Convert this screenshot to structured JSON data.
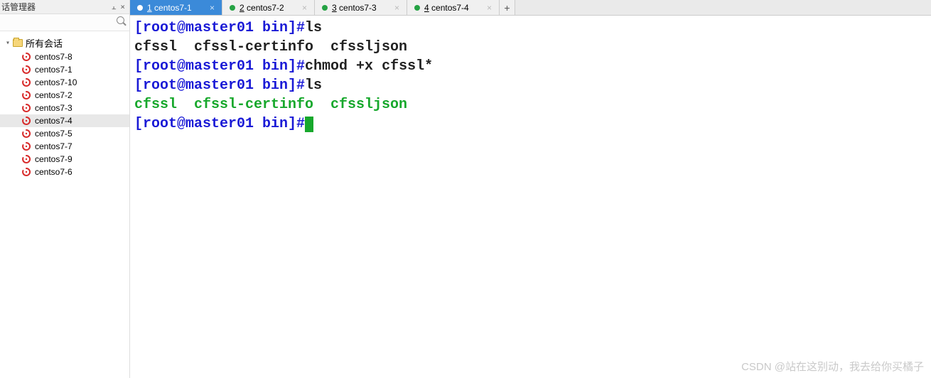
{
  "sidebar": {
    "title": "话管理器",
    "pin_glyph": "⫠",
    "close_glyph": "×",
    "root_label": "所有会话",
    "toggle_glyph": "▾",
    "items": [
      {
        "label": "centos7-8",
        "selected": false
      },
      {
        "label": "centos7-1",
        "selected": false
      },
      {
        "label": "centos7-10",
        "selected": false
      },
      {
        "label": "centos7-2",
        "selected": false
      },
      {
        "label": "centos7-3",
        "selected": false
      },
      {
        "label": "centos7-4",
        "selected": true
      },
      {
        "label": "centos7-5",
        "selected": false
      },
      {
        "label": "centos7-7",
        "selected": false
      },
      {
        "label": "centos7-9",
        "selected": false
      },
      {
        "label": "centso7-6",
        "selected": false
      }
    ]
  },
  "tabs": {
    "items": [
      {
        "num": "1",
        "name": "centos7-1",
        "active": true
      },
      {
        "num": "2",
        "name": "centos7-2",
        "active": false
      },
      {
        "num": "3",
        "name": "centos7-3",
        "active": false
      },
      {
        "num": "4",
        "name": "centos7-4",
        "active": false
      }
    ],
    "close_glyph": "×",
    "add_glyph": "+"
  },
  "terminal": {
    "prompt": "[root@master01 bin]#",
    "lines": {
      "l1_cmd": "ls",
      "l2_out": "cfssl  cfssl-certinfo  cfssljson",
      "l3_cmd": "chmod +x cfssl*",
      "l4_cmd": "ls",
      "l5_out": "cfssl  cfssl-certinfo  cfssljson"
    }
  },
  "watermark": "CSDN @站在这别动，我去给你买橘子"
}
